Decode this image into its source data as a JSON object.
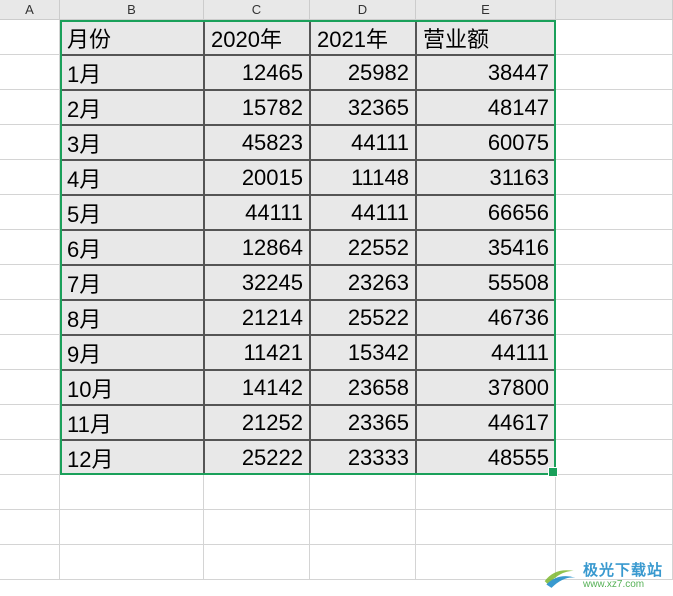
{
  "columns": {
    "A": "A",
    "B": "B",
    "C": "C",
    "D": "D",
    "E": "E"
  },
  "chart_data": {
    "type": "table",
    "title": "",
    "columns": [
      "月份",
      "2020年",
      "2021年",
      "营业额"
    ],
    "rows": [
      [
        "1月",
        12465,
        25982,
        38447
      ],
      [
        "2月",
        15782,
        32365,
        48147
      ],
      [
        "3月",
        45823,
        44111,
        60075
      ],
      [
        "4月",
        20015,
        11148,
        31163
      ],
      [
        "5月",
        44111,
        44111,
        66656
      ],
      [
        "6月",
        12864,
        22552,
        35416
      ],
      [
        "7月",
        32245,
        23263,
        55508
      ],
      [
        "8月",
        21214,
        25522,
        46736
      ],
      [
        "9月",
        11421,
        15342,
        44111
      ],
      [
        "10月",
        14142,
        23658,
        37800
      ],
      [
        "11月",
        21252,
        23365,
        44617
      ],
      [
        "12月",
        25222,
        23333,
        48555
      ]
    ]
  },
  "header": {
    "b": "月份",
    "c": "2020年",
    "d": "2021年",
    "e": "营业额"
  },
  "r1": {
    "b": "1月",
    "c": "12465",
    "d": "25982",
    "e": "38447"
  },
  "r2": {
    "b": "2月",
    "c": "15782",
    "d": "32365",
    "e": "48147"
  },
  "r3": {
    "b": "3月",
    "c": "45823",
    "d": "44111",
    "e": "60075"
  },
  "r4": {
    "b": "4月",
    "c": "20015",
    "d": "11148",
    "e": "31163"
  },
  "r5": {
    "b": "5月",
    "c": "44111",
    "d": "44111",
    "e": "66656"
  },
  "r6": {
    "b": "6月",
    "c": "12864",
    "d": "22552",
    "e": "35416"
  },
  "r7": {
    "b": "7月",
    "c": "32245",
    "d": "23263",
    "e": "55508"
  },
  "r8": {
    "b": "8月",
    "c": "21214",
    "d": "25522",
    "e": "46736"
  },
  "r9": {
    "b": "9月",
    "c": "11421",
    "d": "15342",
    "e": "44111"
  },
  "r10": {
    "b": "10月",
    "c": "14142",
    "d": "23658",
    "e": "37800"
  },
  "r11": {
    "b": "11月",
    "c": "21252",
    "d": "23365",
    "e": "44617"
  },
  "r12": {
    "b": "12月",
    "c": "25222",
    "d": "23333",
    "e": "48555"
  },
  "watermark": {
    "line1": "极光下载站",
    "line2": "www.xz7.com"
  },
  "colors": {
    "selection": "#1aa05a",
    "cellFill": "#e8e8e8"
  }
}
